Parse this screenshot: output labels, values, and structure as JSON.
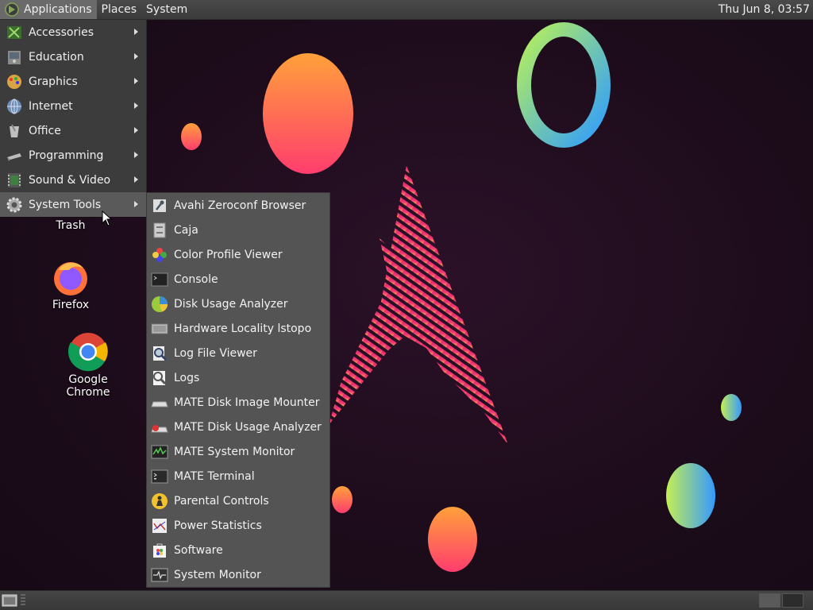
{
  "top_panel": {
    "applications": "Applications",
    "places": "Places",
    "system": "System",
    "clock": "Thu Jun  8, 03:57"
  },
  "apps_menu": {
    "items": [
      {
        "label": "Accessories",
        "icon": "accessories-icon"
      },
      {
        "label": "Education",
        "icon": "education-icon"
      },
      {
        "label": "Graphics",
        "icon": "graphics-icon"
      },
      {
        "label": "Internet",
        "icon": "internet-icon"
      },
      {
        "label": "Office",
        "icon": "office-icon"
      },
      {
        "label": "Programming",
        "icon": "programming-icon"
      },
      {
        "label": "Sound & Video",
        "icon": "sound-video-icon"
      },
      {
        "label": "System Tools",
        "icon": "system-tools-icon",
        "active": true
      }
    ]
  },
  "system_tools_submenu": {
    "items": [
      {
        "label": "Avahi Zeroconf Browser",
        "icon": "avahi-icon"
      },
      {
        "label": "Caja",
        "icon": "caja-icon"
      },
      {
        "label": "Color Profile Viewer",
        "icon": "color-profile-icon"
      },
      {
        "label": "Console",
        "icon": "console-icon"
      },
      {
        "label": "Disk Usage Analyzer",
        "icon": "disk-usage-icon"
      },
      {
        "label": "Hardware Locality lstopo",
        "icon": "hardware-locality-icon"
      },
      {
        "label": "Log File Viewer",
        "icon": "log-viewer-icon"
      },
      {
        "label": "Logs",
        "icon": "logs-icon"
      },
      {
        "label": "MATE Disk Image Mounter",
        "icon": "disk-image-mounter-icon"
      },
      {
        "label": "MATE Disk Usage Analyzer",
        "icon": "mate-disk-usage-icon"
      },
      {
        "label": "MATE System Monitor",
        "icon": "mate-system-monitor-icon"
      },
      {
        "label": "MATE Terminal",
        "icon": "terminal-icon"
      },
      {
        "label": "Parental Controls",
        "icon": "parental-controls-icon"
      },
      {
        "label": "Power Statistics",
        "icon": "power-statistics-icon"
      },
      {
        "label": "Software",
        "icon": "software-icon"
      },
      {
        "label": "System Monitor",
        "icon": "system-monitor-icon"
      }
    ]
  },
  "desktop": {
    "trash": "Trash",
    "firefox": "Firefox",
    "chrome": "Google Chrome"
  }
}
